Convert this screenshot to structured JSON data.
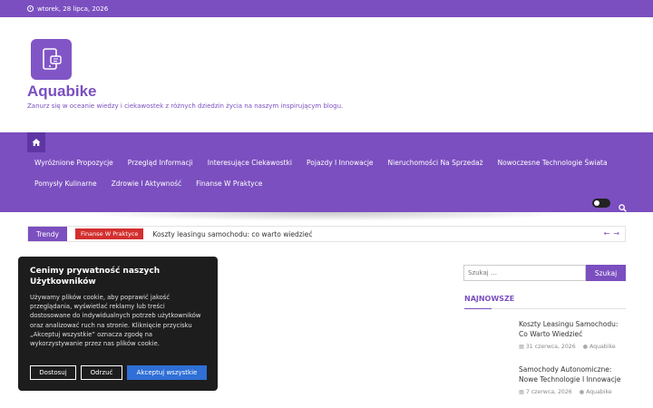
{
  "topbar": {
    "date": "wtorek, 28 lipca, 2026"
  },
  "site": {
    "title": "Aquabike",
    "tagline": "Zanurz się w oceanie wiedzy i ciekawostek z różnych dziedzin życia na naszym inspirującym blogu."
  },
  "nav": {
    "items": [
      "Wyróżnione Propozycje",
      "Przegląd Informacji",
      "Interesujące Ciekawostki",
      "Pojazdy I Innowacje",
      "Nieruchomości Na Sprzedaż",
      "Nowoczesne Technologie Świata",
      "Pomysły Kulinarne",
      "Zdrowie I Aktywność",
      "Finanse W Praktyce"
    ]
  },
  "trending": {
    "label": "Trendy",
    "category": "Finanse W Praktyce",
    "headline": "Koszty leasingu samochodu: co warto wiedzieć"
  },
  "cookie": {
    "title": "Cenimy prywatność naszych Użytkowników",
    "text": "Używamy plików cookie, aby poprawić jakość przeglądania, wyświetlać reklamy lub treści dostosowane do indywidualnych potrzeb użytkowników oraz analizować ruch na stronie. Kliknięcie przycisku „Akceptuj wszystkie” oznacza zgodę na wykorzystywanie przez nas plików cookie.",
    "btn_settings": "Dostosuj",
    "btn_reject": "Odrzuć",
    "btn_accept": "Akceptuj wszystkie"
  },
  "sidebar": {
    "search_placeholder": "Szukaj …",
    "search_button": "Szukaj",
    "widget_title": "NAJNOWSZE",
    "posts": [
      {
        "title": "Koszty Leasingu Samochodu: Co Warto Wiedzieć",
        "date": "31 czerwca, 2026",
        "author": "Aquabike"
      },
      {
        "title": "Samochody Autonomiczne: Nowe Technologie I Innowacje",
        "date": "7 czerwca, 2026",
        "author": "Aquabike"
      }
    ]
  },
  "colors": {
    "brand": "#7b4fbf",
    "accent_red": "#d32f2f",
    "accept_blue": "#2f6fd6"
  }
}
